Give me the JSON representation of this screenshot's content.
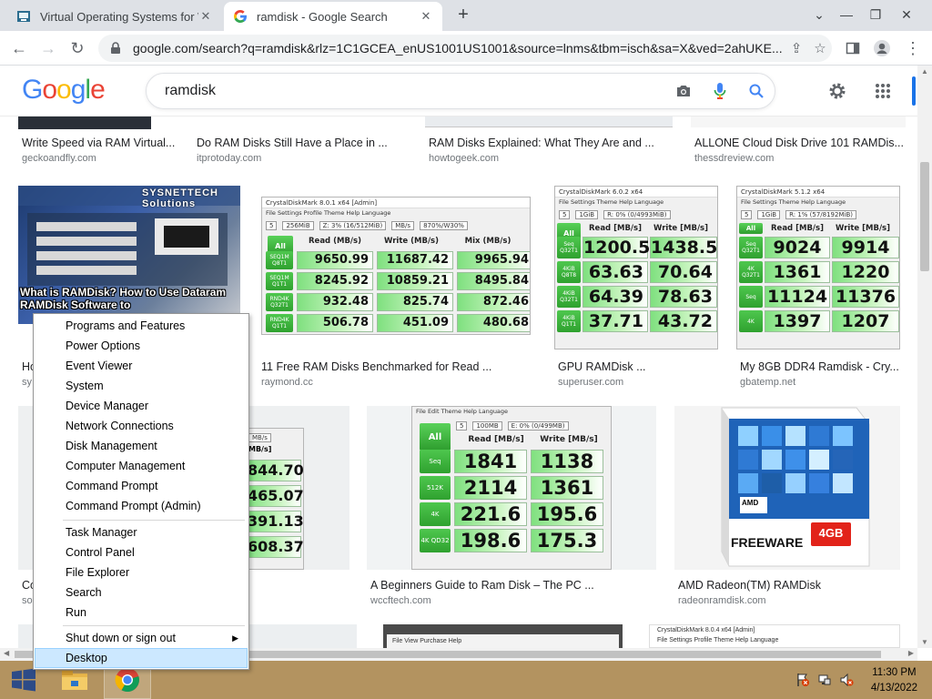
{
  "browser": {
    "tabs": [
      {
        "title": "Virtual Operating Systems for W",
        "active": false
      },
      {
        "title": "ramdisk - Google Search",
        "active": true
      }
    ],
    "url": "google.com/search?q=ramdisk&rlz=1C1GCEA_enUS1001US1001&source=lnms&tbm=isch&sa=X&ved=2ahUKE..."
  },
  "google": {
    "logo": "Google",
    "query": "ramdisk"
  },
  "results": [
    {
      "title": "Write Speed via RAM Virtual...",
      "source": "geckoandfly.com"
    },
    {
      "title": "Do RAM Disks Still Have a Place in ...",
      "source": "itprotoday.com"
    },
    {
      "title": "RAM Disks Explained: What They Are and ...",
      "source": "howtogeek.com"
    },
    {
      "title": "ALLONE Cloud Disk Drive 101 RAMDis...",
      "source": "thessdreview.com"
    },
    {
      "title": "Ho",
      "source": "sy",
      "overlay": "What is RAMDisk? How to Use Dataram RAMDisk Software to",
      "brand": "SYSNETTECH Solutions"
    },
    {
      "title": "11 Free RAM Disks Benchmarked for Read ...",
      "source": "raymond.cc"
    },
    {
      "title": "GPU RAMDisk ...",
      "source": "superuser.com"
    },
    {
      "title": "My 8GB DDR4 Ramdisk - Cry...",
      "source": "gbatemp.net"
    },
    {
      "title": "Co",
      "source": "so"
    },
    {
      "title": "A Beginners Guide to Ram Disk – The PC ...",
      "source": "wccftech.com"
    },
    {
      "title": "AMD Radeon(TM) RAMDisk",
      "source": "radeonramdisk.com",
      "box_brand": "AMD",
      "box_text": "FREEWARE",
      "box_size": "4GB"
    }
  ],
  "benchmarks": {
    "raymond": {
      "window_title": "CrystalDiskMark 8.0.1 x64 [Admin]",
      "menu": "File  Settings  Profile  Theme  Help  Language",
      "controls": [
        "5",
        "256MiB",
        "Z: 3% (16/512MiB)",
        "MB/s",
        "870%/W30%"
      ],
      "all": "All",
      "headers": [
        "Read (MB/s)",
        "Write (MB/s)",
        "Mix (MB/s)"
      ],
      "rows": [
        {
          "label": "SEQ1M Q8T1",
          "values": [
            "9650.99",
            "11687.42",
            "9965.94"
          ]
        },
        {
          "label": "SEQ1M Q1T1",
          "values": [
            "8245.92",
            "10859.21",
            "8495.84"
          ]
        },
        {
          "label": "RND4K Q32T1",
          "values": [
            "932.48",
            "825.74",
            "872.46"
          ]
        },
        {
          "label": "RND4K Q1T1",
          "values": [
            "506.78",
            "451.09",
            "480.68"
          ]
        }
      ]
    },
    "superuser": {
      "window_title": "CrystalDiskMark 6.0.2 x64",
      "menu": "File  Settings  Theme  Help  Language",
      "controls": [
        "5",
        "1GiB",
        "R: 0% (0/4993MiB)"
      ],
      "all": "All",
      "headers": [
        "Read [MB/s]",
        "Write [MB/s]"
      ],
      "rows": [
        {
          "label": "Seq Q32T1",
          "values": [
            "1200.5",
            "1438.5"
          ]
        },
        {
          "label": "4KiB Q8T8",
          "values": [
            "63.63",
            "70.64"
          ]
        },
        {
          "label": "4KiB Q32T1",
          "values": [
            "64.39",
            "78.63"
          ]
        },
        {
          "label": "4KiB Q1T1",
          "values": [
            "37.71",
            "43.72"
          ]
        }
      ]
    },
    "gbatemp": {
      "window_title": "CrystalDiskMark 5.1.2 x64",
      "menu": "File  Settings  Theme  Help  Language",
      "controls": [
        "5",
        "1GiB",
        "R: 1% (57/8192MiB)"
      ],
      "all": "All",
      "headers": [
        "Read [MB/s]",
        "Write [MB/s]"
      ],
      "rows": [
        {
          "label": "Seq Q32T1",
          "values": [
            "9024",
            "9914"
          ]
        },
        {
          "label": "4K Q32T1",
          "values": [
            "1361",
            "1220"
          ]
        },
        {
          "label": "Seq",
          "values": [
            "11124",
            "11376"
          ]
        },
        {
          "label": "4K",
          "values": [
            "1397",
            "1207"
          ]
        }
      ]
    },
    "wccftech": {
      "menu": "File  Edit  Theme  Help  Language",
      "controls": [
        "5",
        "100MB",
        "E: 0% (0/499MB)"
      ],
      "all": "All",
      "headers": [
        "Read [MB/s]",
        "Write [MB/s]"
      ],
      "rows": [
        {
          "label": "Seq",
          "values": [
            "1841",
            "1138"
          ]
        },
        {
          "label": "512K",
          "values": [
            "2114",
            "1361"
          ]
        },
        {
          "label": "4K",
          "values": [
            "221.6",
            "195.6"
          ]
        },
        {
          "label": "4K QD32",
          "values": [
            "198.6",
            "175.3"
          ]
        }
      ]
    },
    "partial": {
      "control": "MB/s",
      "header": "MB/s]",
      "values": [
        "844.70",
        "465.07",
        "391.13",
        "608.37"
      ]
    },
    "bottom_mid": {
      "menu": "File  View  Purchase  Help"
    },
    "bottom_right": {
      "window_title": "CrystalDiskMark 8.0.4 x64 [Admin]",
      "menu": "File  Settings  Profile  Theme  Help  Language"
    }
  },
  "context_menu": {
    "items": [
      {
        "label": "Programs and Features"
      },
      {
        "label": "Power Options"
      },
      {
        "label": "Event Viewer"
      },
      {
        "label": "System"
      },
      {
        "label": "Device Manager"
      },
      {
        "label": "Network Connections"
      },
      {
        "label": "Disk Management"
      },
      {
        "label": "Computer Management"
      },
      {
        "label": "Command Prompt"
      },
      {
        "label": "Command Prompt (Admin)"
      },
      {
        "label": "Task Manager"
      },
      {
        "label": "Control Panel"
      },
      {
        "label": "File Explorer"
      },
      {
        "label": "Search"
      },
      {
        "label": "Run"
      },
      {
        "label": "Shut down or sign out"
      },
      {
        "label": "Desktop"
      }
    ],
    "highlighted": "Desktop"
  },
  "taskbar": {
    "time": "11:30 PM",
    "date": "4/13/2022"
  },
  "colors": {
    "taskbar": "#b39360",
    "google_blue": "#4285f4",
    "google_red": "#ea4335",
    "google_yellow": "#fbbc05",
    "google_green": "#34a853",
    "menu_highlight": "#cce8ff"
  }
}
